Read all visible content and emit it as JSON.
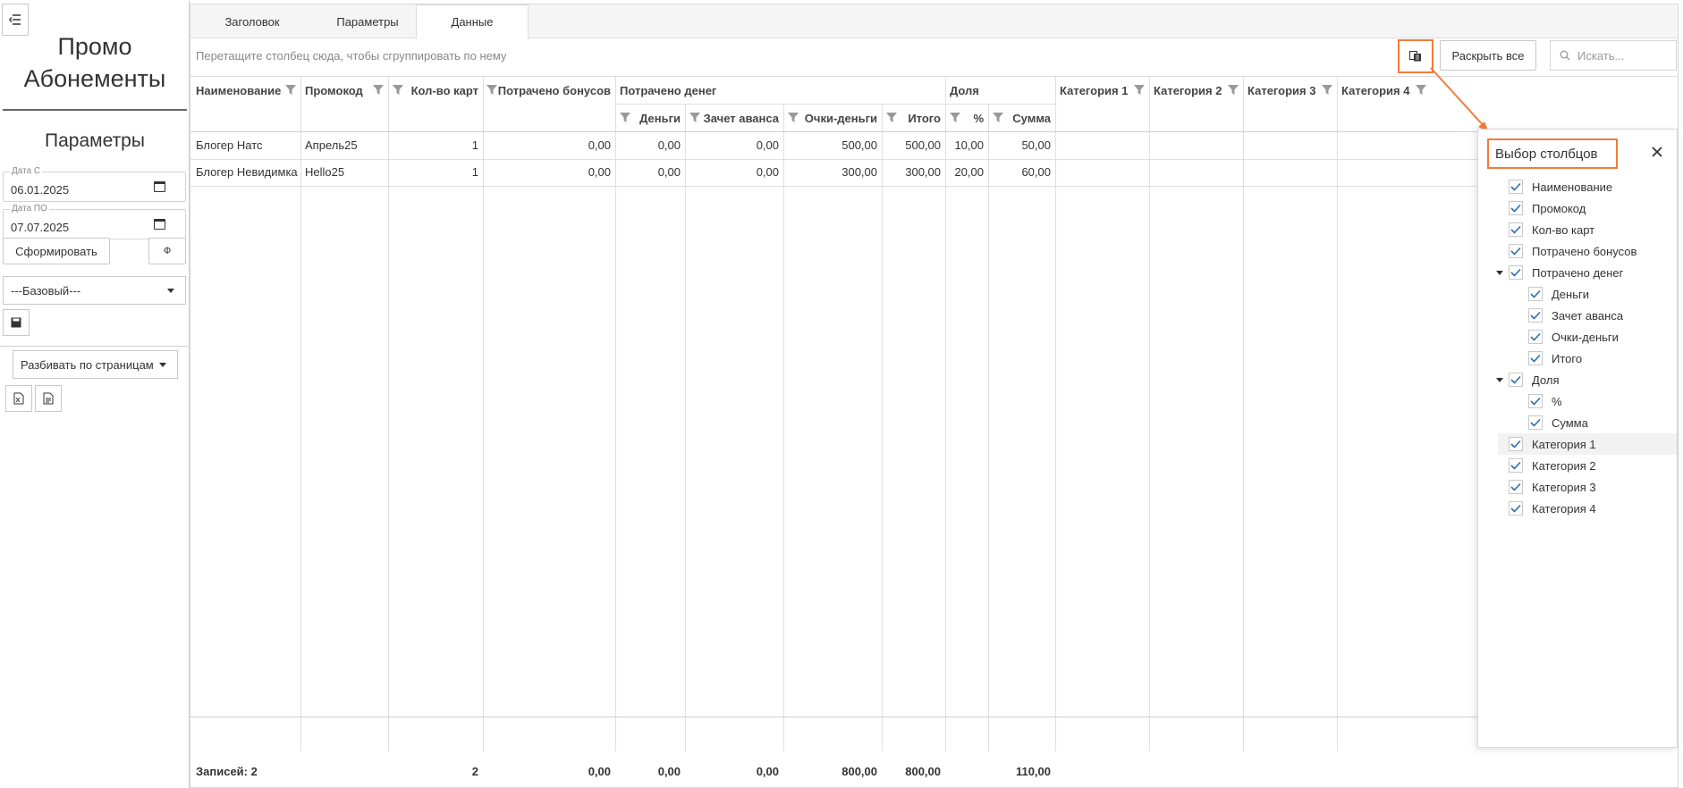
{
  "app": {
    "title": "Промо Абонементы"
  },
  "params": {
    "title": "Параметры",
    "date_from": {
      "label": "Дата С",
      "value": "06.01.2025"
    },
    "date_to": {
      "label": "Дата ПО",
      "value": "07.07.2025"
    },
    "generate_label": "Сформировать",
    "formula_label": "Ф",
    "layout_select": "---Базовый---",
    "paging_select": "Разбивать по страницам"
  },
  "tabs": [
    {
      "label": "Заголовок",
      "active": false
    },
    {
      "label": "Параметры",
      "active": false
    },
    {
      "label": "Данные",
      "active": true
    }
  ],
  "toolbar": {
    "group_hint": "Перетащите столбец сюда, чтобы сгруппировать по нему",
    "expand_all": "Раскрыть все",
    "search_placeholder": "Искать..."
  },
  "grid": {
    "columns": {
      "name": "Наименование",
      "promo": "Промокод",
      "cards": "Кол-во карт",
      "bonus": "Потрачено бонусов",
      "money_group": "Потрачено денег",
      "money": "Деньги",
      "advance": "Зачет аванса",
      "points": "Очки-деньги",
      "total": "Итого",
      "share_group": "Доля",
      "pct": "%",
      "sum": "Сумма",
      "cat1": "Категория 1",
      "cat2": "Категория 2",
      "cat3": "Категория 3",
      "cat4": "Категория 4"
    },
    "rows": [
      {
        "name": "Блогер Натс",
        "promo": "Апрель25",
        "cards": "1",
        "bonus": "0,00",
        "money": "0,00",
        "advance": "0,00",
        "points": "500,00",
        "total": "500,00",
        "pct": "10,00",
        "sum": "50,00"
      },
      {
        "name": "Блогер Невидимка",
        "promo": "Hello25",
        "cards": "1",
        "bonus": "0,00",
        "money": "0,00",
        "advance": "0,00",
        "points": "300,00",
        "total": "300,00",
        "pct": "20,00",
        "sum": "60,00"
      }
    ],
    "footer": {
      "records": "Записей: 2",
      "cards": "2",
      "bonus": "0,00",
      "money": "0,00",
      "advance": "0,00",
      "points": "800,00",
      "total": "800,00",
      "sum": "110,00"
    }
  },
  "chooser": {
    "title": "Выбор столбцов",
    "items": [
      {
        "label": "Наименование",
        "level": 0,
        "expandable": false,
        "checked": true
      },
      {
        "label": "Промокод",
        "level": 0,
        "expandable": false,
        "checked": true
      },
      {
        "label": "Кол-во карт",
        "level": 0,
        "expandable": false,
        "checked": true
      },
      {
        "label": "Потрачено бонусов",
        "level": 0,
        "expandable": false,
        "checked": true
      },
      {
        "label": "Потрачено денег",
        "level": 0,
        "expandable": true,
        "checked": true
      },
      {
        "label": "Деньги",
        "level": 1,
        "expandable": false,
        "checked": true
      },
      {
        "label": "Зачет аванса",
        "level": 1,
        "expandable": false,
        "checked": true
      },
      {
        "label": "Очки-деньги",
        "level": 1,
        "expandable": false,
        "checked": true
      },
      {
        "label": "Итого",
        "level": 1,
        "expandable": false,
        "checked": true
      },
      {
        "label": "Доля",
        "level": 0,
        "expandable": true,
        "checked": true
      },
      {
        "label": "%",
        "level": 1,
        "expandable": false,
        "checked": true
      },
      {
        "label": "Сумма",
        "level": 1,
        "expandable": false,
        "checked": true
      },
      {
        "label": "Категория 1",
        "level": 0,
        "expandable": false,
        "checked": true,
        "hovered": true
      },
      {
        "label": "Категория 2",
        "level": 0,
        "expandable": false,
        "checked": true
      },
      {
        "label": "Категория 3",
        "level": 0,
        "expandable": false,
        "checked": true
      },
      {
        "label": "Категория 4",
        "level": 0,
        "expandable": false,
        "checked": true
      }
    ]
  },
  "colors": {
    "accent": "#f47a3a",
    "check": "#2b6cb0",
    "border": "#d8d8d8"
  }
}
